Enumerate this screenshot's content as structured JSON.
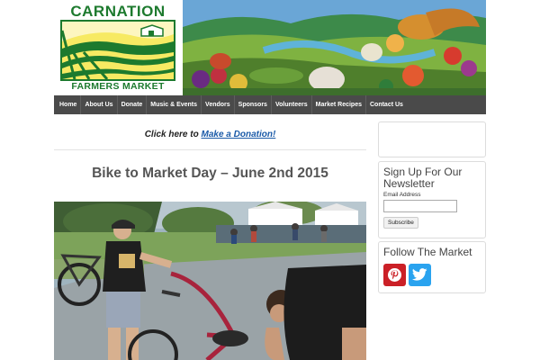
{
  "brand": {
    "title": "CARNATION",
    "subtitle": "FARMERS MARKET",
    "green": "#1d7a2e",
    "yellow": "#f5e65a"
  },
  "nav": {
    "items": [
      "Home",
      "About Us",
      "Donate",
      "Music & Events",
      "Vendors",
      "Sponsors",
      "Volunteers",
      "Market Recipes",
      "Contact Us"
    ]
  },
  "donation": {
    "prefix": "Click here to",
    "link": "Make a Donation!"
  },
  "post": {
    "title": "Bike to Market Day – June 2nd 2015"
  },
  "sidebar": {
    "newsletter": {
      "title": "Sign Up For Our Newsletter",
      "email_label": "Email Address",
      "email_value": "",
      "subscribe_label": "Subscribe"
    },
    "follow": {
      "title": "Follow The Market",
      "icons": [
        "pinterest-icon",
        "twitter-icon"
      ],
      "pinterest_color": "#cb2027",
      "twitter_color": "#2aa3ef"
    }
  }
}
